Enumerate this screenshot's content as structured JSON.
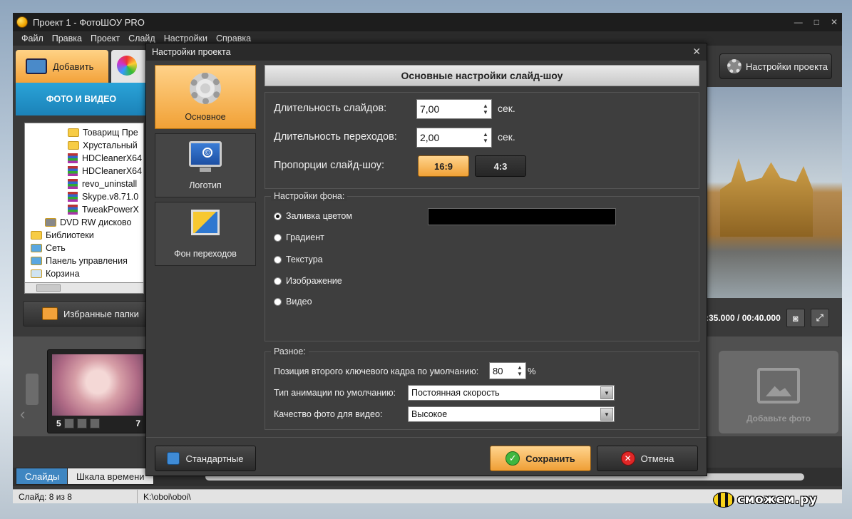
{
  "window": {
    "title": "Проект 1 - ФотоШОУ PRO",
    "controls": [
      "—",
      "□",
      "✕"
    ]
  },
  "menu": [
    "Файл",
    "Правка",
    "Проект",
    "Слайд",
    "Настройки",
    "Справка"
  ],
  "left": {
    "add_tab": "Добавить",
    "photo_header": "ФОТО И ВИДЕО",
    "tree": [
      {
        "label": "Товарищ Пре",
        "type": "folder",
        "indent": 60
      },
      {
        "label": "Хрустальный",
        "type": "folder",
        "indent": 60
      },
      {
        "label": "HDCleanerX64",
        "type": "rar",
        "indent": 60
      },
      {
        "label": "HDCleanerX64",
        "type": "rar",
        "indent": 60
      },
      {
        "label": "revo_uninstall",
        "type": "rar",
        "indent": 60
      },
      {
        "label": "Skype.v8.71.0",
        "type": "rar",
        "indent": 60
      },
      {
        "label": "TweakPowerX",
        "type": "rar",
        "indent": 60
      },
      {
        "label": "DVD RW дисково",
        "type": "drive",
        "indent": 28
      },
      {
        "label": "Библиотеки",
        "type": "folder",
        "indent": 8
      },
      {
        "label": "Сеть",
        "type": "net",
        "indent": 8
      },
      {
        "label": "Панель управления",
        "type": "cp",
        "indent": 8
      },
      {
        "label": "Корзина",
        "type": "bin",
        "indent": 8
      }
    ],
    "favorites_button": "Избранные папки"
  },
  "right": {
    "project_settings_button": "Настройки проекта",
    "time": ":35.000 / 00:40.000"
  },
  "film": {
    "slide_number": "5",
    "slide_trail": "7",
    "add_photo": "Добавьте фото"
  },
  "bottom_tabs": [
    "Слайды",
    "Шкала времени"
  ],
  "status": {
    "slide": "Слайд: 8 из 8",
    "path": "K:\\oboi\\oboi\\"
  },
  "watermark": "сможем.ру",
  "dialog": {
    "title": "Настройки проекта",
    "side": [
      "Основное",
      "Логотип",
      "Фон переходов"
    ],
    "section_title": "Основные настройки слайд-шоу",
    "slide_duration_label": "Длительность слайдов:",
    "slide_duration_value": "7,00",
    "transition_duration_label": "Длительность переходов:",
    "transition_duration_value": "2,00",
    "unit_sec": "сек.",
    "ratio_label": "Пропорции слайд-шоу:",
    "ratio_options": [
      "16:9",
      "4:3"
    ],
    "ratio_selected": "16:9",
    "bg_group_title": "Настройки фона",
    "bg_options": [
      "Заливка цветом",
      "Градиент",
      "Текстура",
      "Изображение",
      "Видео"
    ],
    "bg_selected": "Заливка цветом",
    "bg_color": "#000000",
    "misc_group_title": "Разное",
    "keyframe_label": "Позиция второго ключевого кадра по умолчанию:",
    "keyframe_value": "80",
    "keyframe_unit": "%",
    "animation_label": "Тип анимации по умолчанию:",
    "animation_value": "Постоянная скорость",
    "quality_label": "Качество фото для видео:",
    "quality_value": "Высокое",
    "btn_default": "Стандартные",
    "btn_save": "Сохранить",
    "btn_cancel": "Отмена"
  }
}
